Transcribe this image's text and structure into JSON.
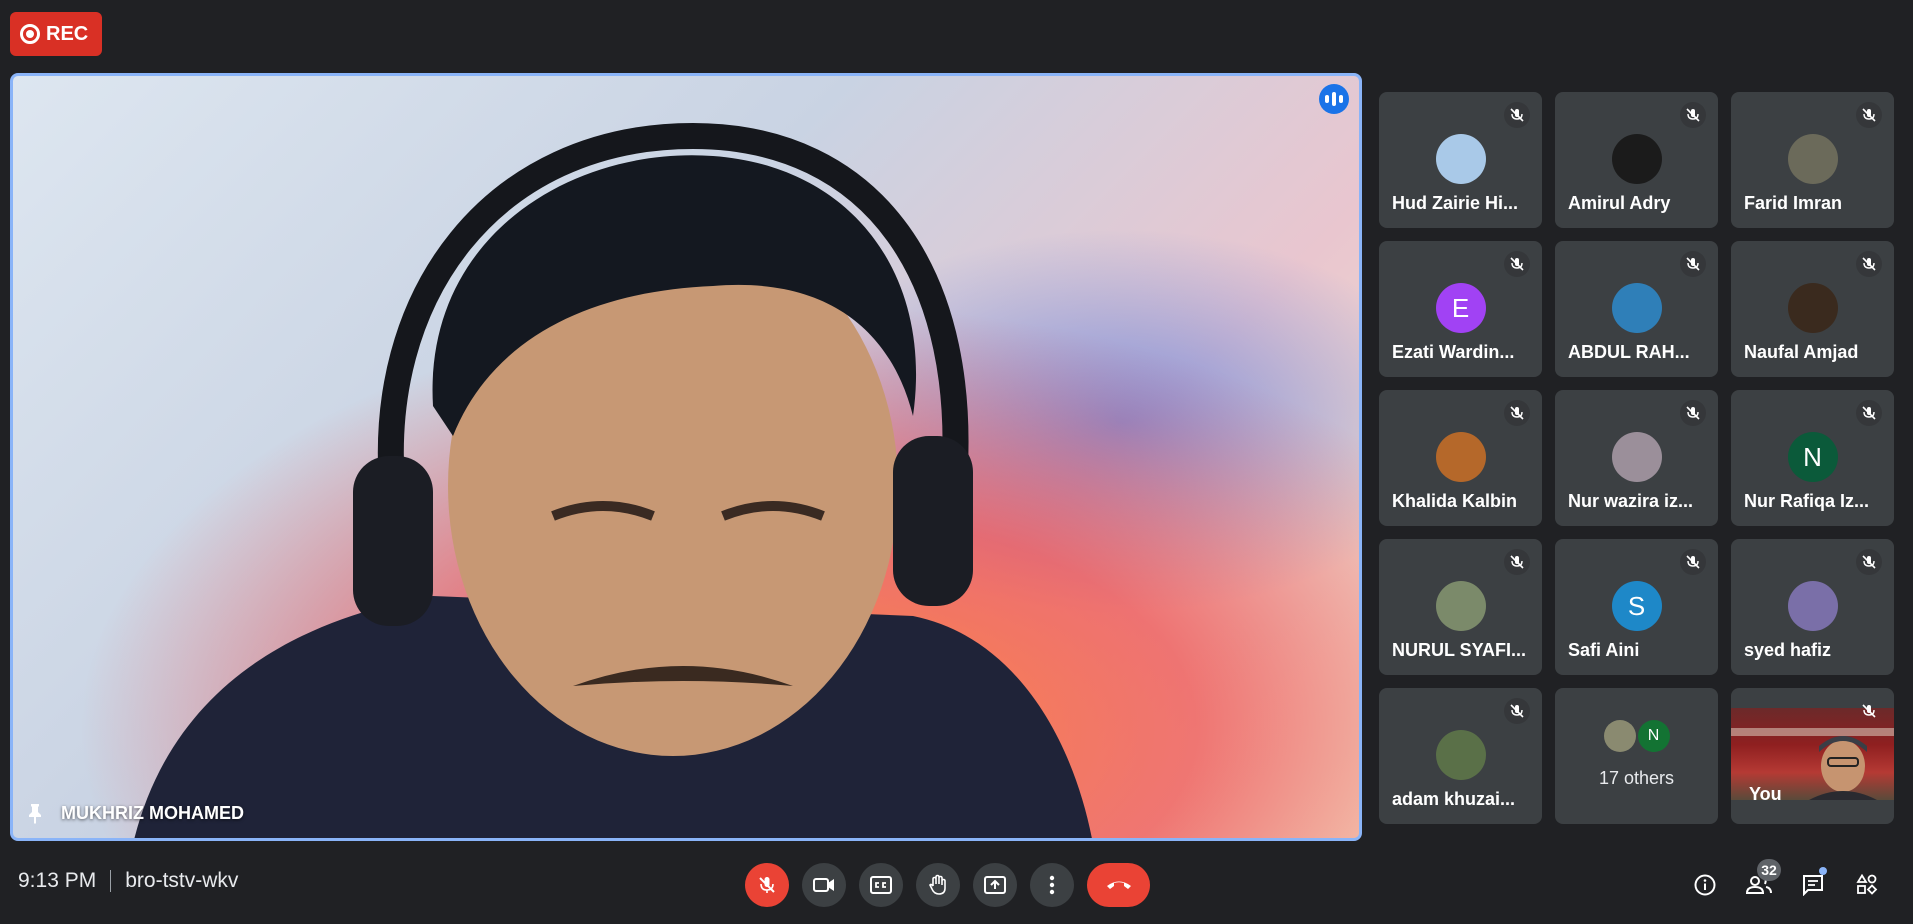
{
  "recording": {
    "label": "REC"
  },
  "main_speaker": {
    "name": "MUKHRIZ MOHAMED"
  },
  "participants": [
    {
      "name": "Hud Zairie Hi...",
      "avatar_letter": "",
      "avatar_color": "#a9c9e8"
    },
    {
      "name": "Amirul Adry",
      "avatar_letter": "",
      "avatar_color": "#1b1b1b"
    },
    {
      "name": "Farid Imran",
      "avatar_letter": "",
      "avatar_color": "#6b6a5a"
    },
    {
      "name": "Ezati Wardin...",
      "avatar_letter": "E",
      "avatar_color": "#a142f4"
    },
    {
      "name": "ABDUL RAH...",
      "avatar_letter": "",
      "avatar_color": "#2f7fb8"
    },
    {
      "name": "Naufal Amjad",
      "avatar_letter": "",
      "avatar_color": "#3a2a1e"
    },
    {
      "name": "Khalida Kalbin",
      "avatar_letter": "",
      "avatar_color": "#b5682a"
    },
    {
      "name": "Nur wazira iz...",
      "avatar_letter": "",
      "avatar_color": "#9b8f9a"
    },
    {
      "name": "Nur Rafiqa Iz...",
      "avatar_letter": "N",
      "avatar_color": "#0b5a3a"
    },
    {
      "name": "NURUL SYAFI...",
      "avatar_letter": "",
      "avatar_color": "#7b8a6a"
    },
    {
      "name": "Safi Aini",
      "avatar_letter": "S",
      "avatar_color": "#1e88c8"
    },
    {
      "name": "syed hafiz",
      "avatar_letter": "",
      "avatar_color": "#7a6fa8"
    },
    {
      "name": "adam khuzai...",
      "avatar_letter": "",
      "avatar_color": "#5a7048"
    }
  ],
  "others": {
    "label": "17 others",
    "avatar_letter": "N",
    "avatar_color": "#137333",
    "photo_color": "#8a8a70"
  },
  "self": {
    "label": "You"
  },
  "meeting": {
    "time": "9:13 PM",
    "code": "bro-tstv-wkv"
  },
  "people_count": "32",
  "colors": {
    "accent": "#8ab4f8",
    "danger": "#ea4335",
    "tile": "#3c4043",
    "background": "#202124"
  }
}
